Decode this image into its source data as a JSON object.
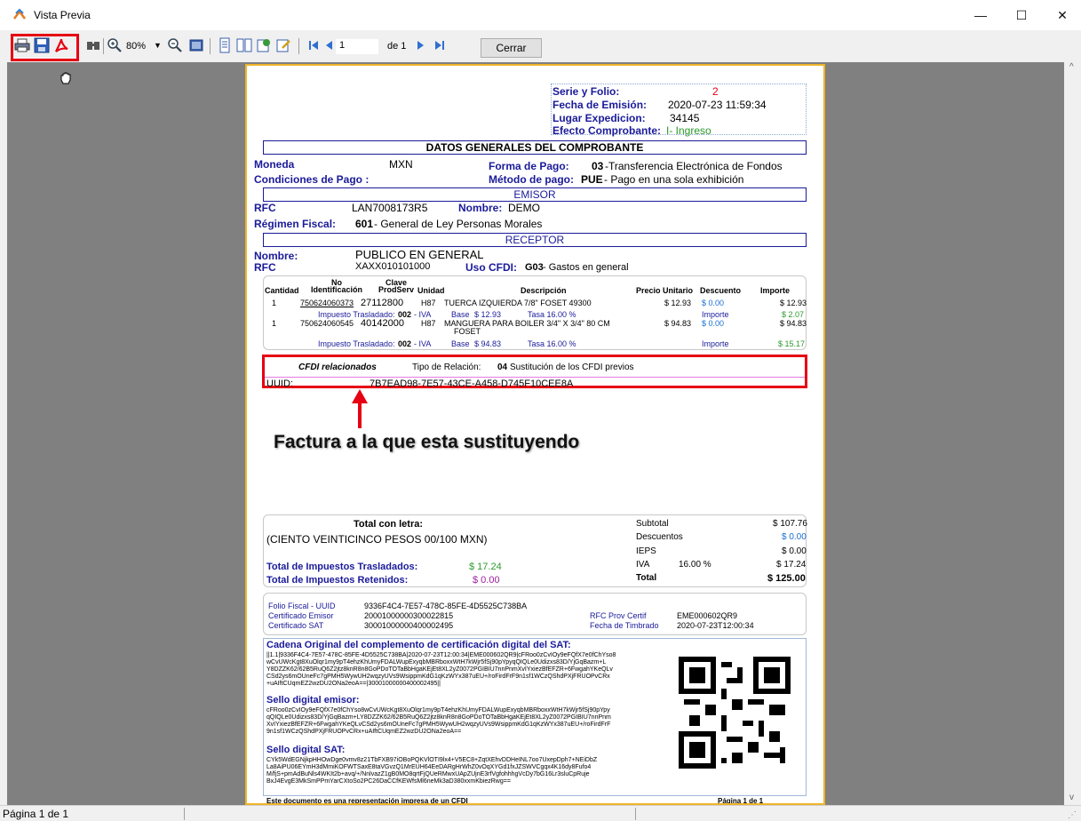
{
  "window": {
    "title": "Vista Previa",
    "minimize": "—",
    "maximize": "☐",
    "close": "✕"
  },
  "toolbar": {
    "zoom": "80%",
    "page_value": "1",
    "page_of": "de 1",
    "close_label": "Cerrar",
    "icons": [
      "print-icon",
      "save-icon",
      "pdf-icon",
      "find-icon",
      "zoom-in-icon",
      "zoom-out-icon",
      "full-page-icon",
      "one-page-icon",
      "two-pages-icon",
      "export-icon",
      "edit-icon",
      "first-page-icon",
      "prev-page-icon",
      "next-page-icon",
      "last-page-icon"
    ]
  },
  "invoice": {
    "header": {
      "serie_label": "Serie y Folio:",
      "serie_value": "2",
      "fecha_label": "Fecha de Emisión:",
      "fecha_value": "2020-07-23  11:59:34",
      "lugar_label": "Lugar Expedicion:",
      "lugar_value": "34145",
      "efecto_label": "Efecto Comprobante:",
      "efecto_value": "I- Ingreso"
    },
    "datos_generales": "DATOS GENERALES DEL COMPROBANTE",
    "moneda_label": "Moneda",
    "moneda_value": "MXN",
    "forma_pago_label": "Forma de Pago:",
    "forma_pago_code": "03",
    "forma_pago_value": "-Transferencia Electrónica de Fondos",
    "condiciones_label": "Condiciones de Pago :",
    "metodo_label": "Método de pago:",
    "metodo_code": "PUE",
    "metodo_value": " - Pago en una sola exhibición",
    "emisor_title": "EMISOR",
    "emisor_rfc_label": "RFC",
    "emisor_rfc": "LAN7008173R5",
    "emisor_nombre_label": "Nombre:",
    "emisor_nombre": "DEMO",
    "regimen_label": "Régimen Fiscal:",
    "regimen_code": "601",
    "regimen_value": " - General de Ley Personas Morales",
    "receptor_title": "RECEPTOR",
    "receptor_nombre_label": "Nombre:",
    "receptor_nombre": "PUBLICO EN GENERAL",
    "receptor_rfc_label": "RFC",
    "receptor_rfc": "XAXX010101000",
    "uso_label": "Uso CFDI:",
    "uso_code": "G03",
    "uso_value": " - Gastos en general",
    "cols": {
      "cantidad": "Cantidad",
      "no_id": "No\nIdentificación",
      "clave": "Clave\nProdServ",
      "unidad": "Unidad",
      "descripcion": "Descripción",
      "precio": "Precio Unitario",
      "descuento": "Descuento",
      "importe": "Importe"
    },
    "items": [
      {
        "cantidad": "1",
        "no_id": "750624060373",
        "clave": "27112800",
        "unidad": "H87",
        "descripcion": "TUERCA IZQUIERDA 7/8\" FOSET 49300",
        "desc2": "",
        "precio": "$ 12.93",
        "descuento": "$ 0.00",
        "importe": "$ 12.93",
        "imp_label": "Impuesto Trasladado:",
        "imp_code": "002",
        "imp_name": " - IVA",
        "base_label": "Base",
        "base": "$ 12.93",
        "tasa": "Tasa 16.00 %",
        "imp_importe_label": "Importe",
        "imp_importe": "$ 2.07"
      },
      {
        "cantidad": "1",
        "no_id": "750624060545",
        "clave": "40142000",
        "unidad": "H87",
        "descripcion": "MANGUERA PARA BOILER 3/4\" X 3/4\" 80 CM",
        "desc2": "FOSET",
        "precio": "$ 94.83",
        "descuento": "$ 0.00",
        "importe": "$ 94.83",
        "imp_label": "Impuesto Trasladado:",
        "imp_code": "002",
        "imp_name": " - IVA",
        "base_label": "Base",
        "base": "$ 94.83",
        "tasa": "Tasa 16.00 %",
        "imp_importe_label": "Importe",
        "imp_importe": "$ 15.17"
      }
    ],
    "cfdi_rel_label": "CFDI relacionados",
    "tipo_rel_label": "Tipo de Relación:",
    "tipo_rel_code": "04",
    "tipo_rel_value": "Sustitución de los CFDI previos",
    "uuid_label": "UUID:",
    "uuid_value": "7B7EAD98-7E57-43CE-A458-D745F10CEE8A",
    "annotation": "Factura a la que esta sustituyendo",
    "totals": {
      "letra_label": "Total con letra:",
      "letra_value": "(CIENTO VEINTICINCO PESOS 00/100 MXN)",
      "tras_label": "Total de Impuestos Trasladados:",
      "tras_value": "$ 17.24",
      "ret_label": "Total de Impuestos Retenidos:",
      "ret_value": "$ 0.00",
      "subtotal_label": "Subtotal",
      "subtotal": "$ 107.76",
      "desc_label": "Descuentos",
      "desc": "$ 0.00",
      "ieps_label": "IEPS",
      "ieps": "$ 0.00",
      "iva_label": "IVA",
      "iva_rate": "16.00 %",
      "iva": "$ 17.24",
      "total_label": "Total",
      "total": "$ 125.00"
    },
    "cert": {
      "folio_label": "Folio Fiscal - UUID",
      "folio": "9336F4C4-7E57-478C-85FE-4D5525C738BA",
      "cert_emisor_label": "Certificado Emisor",
      "cert_emisor": "20001000000300022815",
      "cert_sat_label": "Certificado SAT",
      "cert_sat": "30001000000400002495",
      "rfc_prov_label": "RFC Prov Certif",
      "rfc_prov": "EME000602QR9",
      "fecha_timbrado_label": "Fecha de Timbrado",
      "fecha_timbrado": "2020-07-23T12:00:34"
    },
    "cadena_title": "Cadena Original del complemento de certificación digital del SAT:",
    "cadena_lines": [
      "||1.1|9336F4C4-7E57-478C-85FE-4D5525C738BA|2020-07-23T12:00:34|EME000602QR9|cFRoo0zCvIOy9eFQfX7e0fChYso8",
      "wCvUWcKgt8XuOlqr1my9pT4ehzKhUmyFDALWupExyqbMBRboxxWtH7kWjr5fSj90pYpyqQIQLe0Udizxs83D/YjGqBazm+L",
      "Y8DZZK62/62B5RuQ6Z2jtz8knR8n8GoPDoTOTaBbHgaKEjEt8XL2yZ0072PGIBIU7nnPnmXvIYxiezBfEFZR+6FwgahYKeQLv",
      "CSd2ys6mOUneFc7gPMH5WywUH2wqzyUVs9WsippmKdG1qKzWYx387uEU+/roFirdFrF9n1sf1WCzQShdPXjFRUOPvCRx",
      "+uAIftCUqmEZ2wzDU2ONa2eoA==|30001000000400002495||"
    ],
    "sello_emisor_title": "Sello digital emisor:",
    "sello_emisor_lines": [
      "cFRoo0zCvIOy9eFQfX7e0fChYso8wCvUWcKgt8XuOlqr1my9pT4ehzKhUmyFDALWupExyqbMBRboxxWtH7kWjr5fSj90pYpy",
      "qQIQLe0Udizxs83D/YjGqBazm+LY8DZZK62/62B5RuQ6Z2jtz8knR8n8GoPDoTOTaBbHgaKEjEt8XL2yZ0072PGIBIU7nnPnm",
      "XvIYxiezBfEFZR+6FwgahYKeQLvCSd2ys6mOUneFc7gPMH5WywUH2wqzyUVs9WsippmKdG1qKzWYx387uEU+/roFirdFrF",
      "9n1sf1WCzQShdPXjFRUOPvCRx+uAIftCUqmEZ2wzDU2ONa2eoA=="
    ],
    "sello_sat_title": "Sello digital SAT:",
    "sello_sat_lines": [
      "CYk5WdEGNjkpHHOwDge0vmv8z21TbFXB97iOBoPQKVlOTI9lx4+V5EC8+ZqtXEhvDDHeINL7oo7UxepDph7+NEiDbZ",
      "La8AiPU06EYmH3dMmiKOFWTSaxE8taVGvzQ1MrEUH64EeDARgHrWhZ0vOqXYGd1fxJZSWVCgqx4K16dy8Fufo4",
      "M/fjS+pmAdBuNls4WKIt2b+avq/+/NnlvazZ1gB0MO8qrtFjQUeRMwxUApZUjnE3rfVgfohhhgVcDy7bG16Lr3sluCpRuje",
      "BxJ4EvgE3MkSmPPmYarCXtoSo2PC26DaCCfKEWfsMl6neMk3aD380xxmKbiezRwg=="
    ],
    "footer_left": "Este documento es una representación impresa de un CFDI",
    "footer_right": "Página 1 de 1"
  },
  "status": {
    "text": "Página 1 de 1"
  }
}
